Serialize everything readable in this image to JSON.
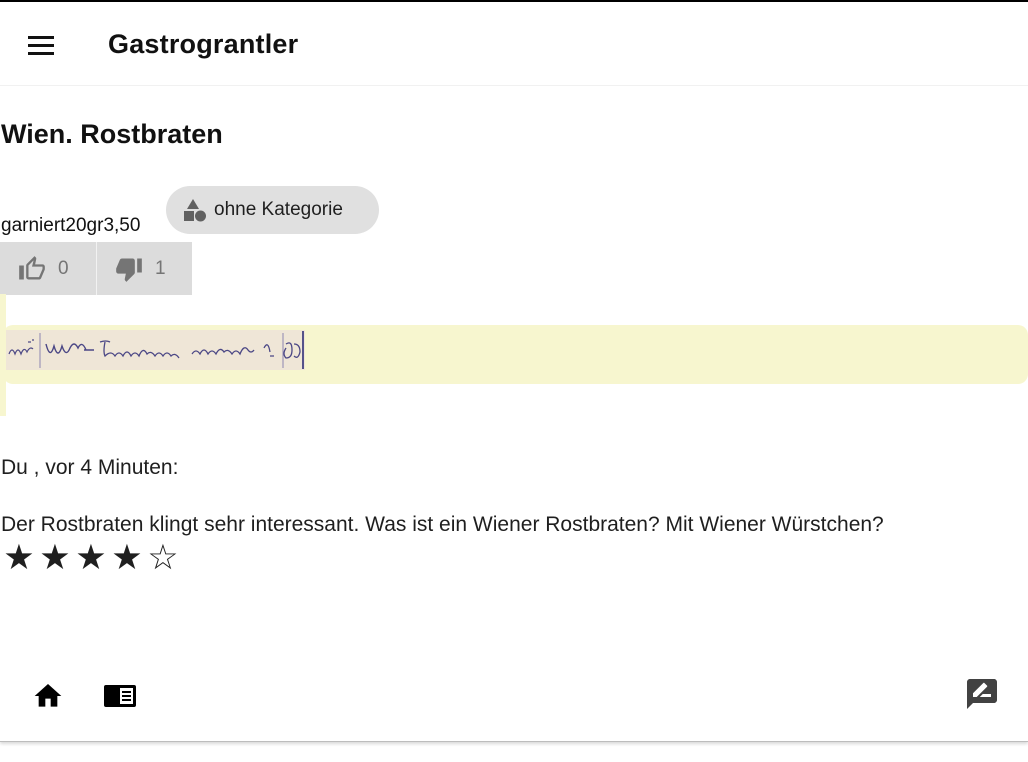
{
  "header": {
    "title": "Gastrograntler",
    "menu_icon": "menu-icon"
  },
  "dish": {
    "title": "Wien. Rostbraten",
    "description": "garniert20gr3,50",
    "category_chip": {
      "label": "ohne Kategorie",
      "icon": "category-shapes-icon"
    },
    "votes": {
      "up_icon": "thumb-up-icon",
      "up_count": "0",
      "down_icon": "thumb-down-icon",
      "down_count": "1"
    },
    "scan_image": {
      "description": "handwritten menu line scan",
      "highlight_color": "#f7f6cf"
    }
  },
  "comment": {
    "meta": "Du , vor 4 Minuten:",
    "text": "Der Rostbraten klingt sehr interessant. Was ist ein Wiener Rostbraten? Mit Wiener Würstchen?",
    "rating": 4,
    "rating_max": 5
  },
  "bottom_nav": {
    "items": [
      {
        "name": "home",
        "icon": "home-icon"
      },
      {
        "name": "menu",
        "icon": "menu-book-icon"
      },
      {
        "name": "feedback",
        "icon": "feedback-icon"
      }
    ]
  }
}
